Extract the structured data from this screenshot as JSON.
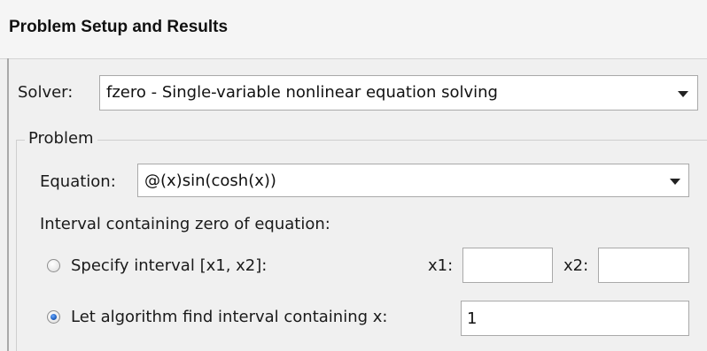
{
  "panel": {
    "title": "Problem Setup and Results"
  },
  "solver": {
    "label": "Solver:",
    "selected": "fzero - Single-variable nonlinear equation solving"
  },
  "problem": {
    "group_title": "Problem",
    "equation_label": "Equation:",
    "equation_value": "@(x)sin(cosh(x))",
    "interval_heading": "Interval containing zero of equation:",
    "option_specify_label": "Specify interval [x1, x2]:",
    "option_specify_selected": false,
    "x1_label": "x1:",
    "x1_value": "",
    "x2_label": "x2:",
    "x2_value": "",
    "option_auto_label": "Let algorithm find interval containing x:",
    "option_auto_selected": true,
    "x_value": "1"
  },
  "icons": {
    "dropdown": "chevron-down-icon",
    "radio": "radio-button"
  },
  "colors": {
    "radio_selected": "#1f5fbf",
    "background": "#f0f0f0",
    "field_border": "#a9a9a9"
  }
}
